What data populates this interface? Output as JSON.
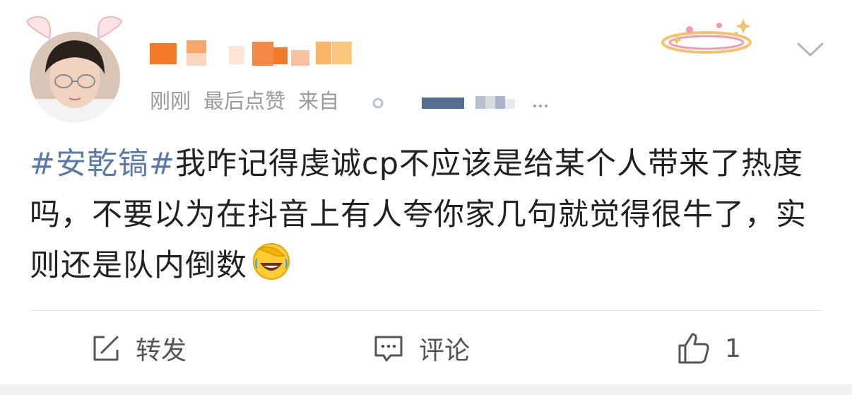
{
  "post": {
    "time": "刚刚",
    "status": "最后点赞",
    "source_prefix": "来自",
    "hashtag": "#安乾镐#",
    "body": "我咋记得虔诚cp不应该是给某个人带来了热度吗，不要以为在抖音上有人夸你家几句就觉得很牛了，实则还是队内倒数"
  },
  "actions": {
    "repost_label": "转发",
    "comment_label": "评论",
    "like_count": "1"
  },
  "icons": {
    "more": "chevron-down-icon",
    "repost": "repost-icon",
    "comment": "comment-icon",
    "like": "thumbs-up-icon",
    "emoji": "facepalm-laugh-emoji-icon"
  },
  "colors": {
    "hashtag": "#5b7aa8",
    "meta": "#9b9b9b",
    "text": "#222222"
  }
}
